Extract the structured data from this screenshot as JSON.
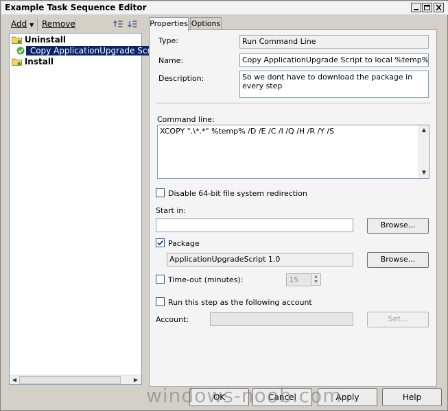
{
  "window": {
    "title": "Example Task Sequence Editor"
  },
  "toolbar": {
    "add": "Add",
    "remove": "Remove"
  },
  "tree": {
    "items": [
      {
        "label": "Uninstall"
      },
      {
        "label": "Copy ApplicationUpgrade Script"
      },
      {
        "label": "Install"
      }
    ]
  },
  "tabs": [
    {
      "label": "Properties"
    },
    {
      "label": "Options"
    }
  ],
  "properties": {
    "type_label": "Type:",
    "type_value": "Run Command Line",
    "name_label": "Name:",
    "name_value": "Copy ApplicationUpgrade Script to local %temp%",
    "description_label": "Description:",
    "description_value": "So we dont have to download the package in every step",
    "command_line_label": "Command line:",
    "command_line_value": "XCOPY \".\\*.*\" %temp% /D /E /C /I /Q /H /R /Y /S",
    "disable_redirection_label": "Disable 64-bit file system redirection",
    "start_in_label": "Start in:",
    "start_in_value": "",
    "browse_label": "Browse...",
    "package_label": "Package",
    "package_value": "ApplicationUpgradeScript 1.0",
    "timeout_label": "Time-out (minutes):",
    "timeout_value": "15",
    "run_as_label": "Run this step as the following account",
    "account_label": "Account:",
    "account_value": "",
    "set_label": "Set..."
  },
  "states": {
    "disable_redirection": false,
    "package": true,
    "timeout": false,
    "run_as": false
  },
  "dialog": {
    "ok": "OK",
    "cancel": "Cancel",
    "apply": "Apply",
    "help": "Help"
  },
  "watermark": "windows-noob.com",
  "colors": {
    "selection": "#0a246a",
    "field_border": "#7f9db9"
  }
}
